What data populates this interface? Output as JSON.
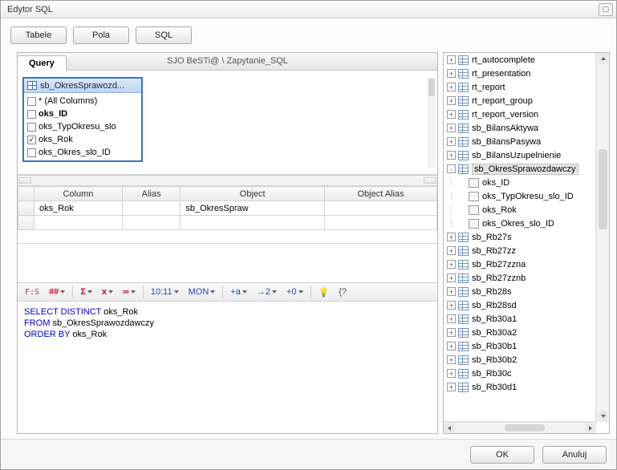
{
  "window": {
    "title": "Edytor SQL"
  },
  "toolbar": {
    "tables": "Tabele",
    "fields": "Pola",
    "sql": "SQL"
  },
  "query": {
    "tab_label": "Query",
    "path": "SJO BeSTi@ \\ Zapytanie_SQL"
  },
  "designer_table": {
    "title": "sb_OkresSprawozd...",
    "columns": [
      {
        "label": "* (All Columns)",
        "checked": false,
        "bold": false
      },
      {
        "label": "oks_ID",
        "checked": false,
        "bold": true
      },
      {
        "label": "oks_TypOkresu_slo",
        "checked": false,
        "bold": false
      },
      {
        "label": "oks_Rok",
        "checked": true,
        "bold": false
      },
      {
        "label": "oks_Okres_slo_ID",
        "checked": false,
        "bold": false
      }
    ]
  },
  "grid": {
    "headers": {
      "column": "Column",
      "alias": "Alias",
      "object": "Object",
      "object_alias": "Object Alias"
    },
    "rows": [
      {
        "column": "oks_Rok",
        "alias": "",
        "object": "sb_OkresSpraw",
        "object_alias": ""
      }
    ]
  },
  "sql_toolbar": {
    "items": [
      "##",
      "Σ",
      "x",
      "∞",
      "10:11",
      "MON",
      "+a",
      "→2",
      "+0"
    ]
  },
  "sql": {
    "line1_kw": "SELECT DISTINCT",
    "line1_rest": " oks_Rok",
    "line2_kw": "FROM",
    "line2_rest": " sb_OkresSprawozdawczy",
    "line3_kw": "ORDER BY",
    "line3_rest": " oks_Rok"
  },
  "tree": [
    {
      "level": 1,
      "expander": "+",
      "icon": "table",
      "label": "rt_autocomplete"
    },
    {
      "level": 1,
      "expander": "+",
      "icon": "table",
      "label": "rt_presentation"
    },
    {
      "level": 1,
      "expander": "+",
      "icon": "table",
      "label": "rt_report"
    },
    {
      "level": 1,
      "expander": "+",
      "icon": "table",
      "label": "rt_report_group"
    },
    {
      "level": 1,
      "expander": "+",
      "icon": "table",
      "label": "rt_report_version"
    },
    {
      "level": 1,
      "expander": "+",
      "icon": "table",
      "label": "sb_BilansAktywa"
    },
    {
      "level": 1,
      "expander": "+",
      "icon": "table",
      "label": "sb_BilansPasywa"
    },
    {
      "level": 1,
      "expander": "+",
      "icon": "table",
      "label": "sb_BilansUzupelnienie"
    },
    {
      "level": 1,
      "expander": "-",
      "icon": "table",
      "label": "sb_OkresSprawozdawczy",
      "selected": true
    },
    {
      "level": 2,
      "expander": "",
      "icon": "col",
      "label": "oks_ID"
    },
    {
      "level": 2,
      "expander": "",
      "icon": "col",
      "label": "oks_TypOkresu_slo_ID"
    },
    {
      "level": 2,
      "expander": "",
      "icon": "col",
      "label": "oks_Rok"
    },
    {
      "level": 2,
      "expander": "",
      "icon": "col",
      "label": "oks_Okres_slo_ID"
    },
    {
      "level": 1,
      "expander": "+",
      "icon": "table",
      "label": "sb_Rb27s"
    },
    {
      "level": 1,
      "expander": "+",
      "icon": "table",
      "label": "sb_Rb27zz"
    },
    {
      "level": 1,
      "expander": "+",
      "icon": "table",
      "label": "sb_Rb27zzna"
    },
    {
      "level": 1,
      "expander": "+",
      "icon": "table",
      "label": "sb_Rb27zznb"
    },
    {
      "level": 1,
      "expander": "+",
      "icon": "table",
      "label": "sb_Rb28s"
    },
    {
      "level": 1,
      "expander": "+",
      "icon": "table",
      "label": "sb_Rb28sd"
    },
    {
      "level": 1,
      "expander": "+",
      "icon": "table",
      "label": "sb_Rb30a1"
    },
    {
      "level": 1,
      "expander": "+",
      "icon": "table",
      "label": "sb_Rb30a2"
    },
    {
      "level": 1,
      "expander": "+",
      "icon": "table",
      "label": "sb_Rb30b1"
    },
    {
      "level": 1,
      "expander": "+",
      "icon": "table",
      "label": "sb_Rb30b2"
    },
    {
      "level": 1,
      "expander": "+",
      "icon": "table",
      "label": "sb_Rb30c"
    },
    {
      "level": 1,
      "expander": "+",
      "icon": "table",
      "label": "sb_Rb30d1"
    }
  ],
  "footer": {
    "ok": "OK",
    "cancel": "Anuluj"
  }
}
